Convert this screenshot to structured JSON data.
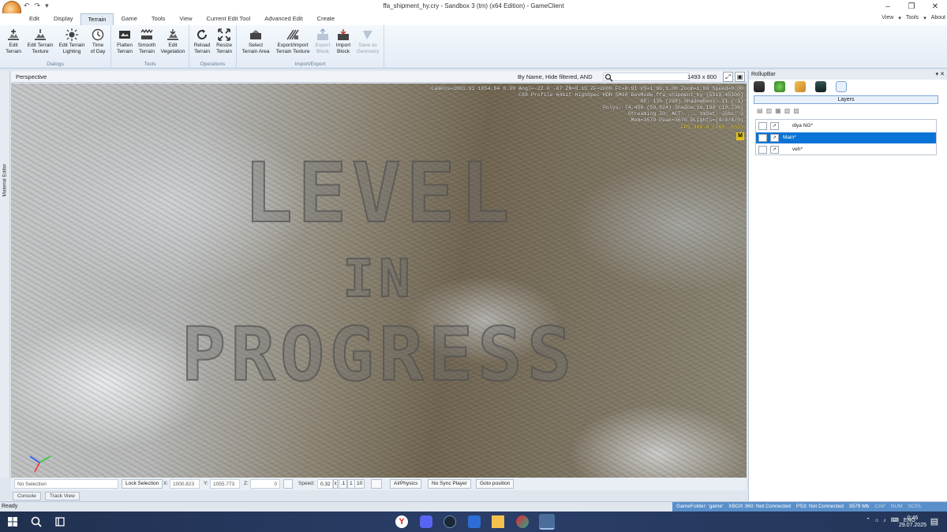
{
  "window": {
    "title": "ffa_shipment_hy.cry - Sandbox 3 (tm) (x64 Edition) - GameClient",
    "quick_access": [
      "↶",
      "↷",
      "▾"
    ],
    "controls": [
      "–",
      "❐",
      "✕"
    ]
  },
  "ribbon": {
    "tabs": [
      "Edit",
      "Display",
      "Terrain",
      "Game",
      "Tools",
      "View",
      "Current Edit Tool",
      "Advanced Edit",
      "Create"
    ],
    "active_tab": "Terrain",
    "right_menu": [
      "View",
      "Tools",
      "About"
    ],
    "groups": [
      {
        "label": "Dialogs",
        "buttons": [
          [
            "Edit",
            "Terrain"
          ],
          [
            "Edit Terrain",
            "Texture"
          ],
          [
            "Edit Terrain",
            "Lighting"
          ],
          [
            "Time",
            "of Day"
          ]
        ]
      },
      {
        "label": "Tools",
        "buttons": [
          [
            "Flatten",
            "Terrain"
          ],
          [
            "Smooth",
            "Terrain"
          ],
          [
            "Edit",
            "Vegetation"
          ]
        ]
      },
      {
        "label": "Operations",
        "buttons": [
          [
            "Reload",
            "Terrain"
          ],
          [
            "Resize",
            "Terrain"
          ]
        ]
      },
      {
        "label": "Import/Export",
        "buttons": [
          [
            "Select",
            "Terrain Area"
          ],
          [
            "Export/Import",
            "Terrain Texture"
          ],
          [
            "Export",
            "Block"
          ],
          [
            "Import",
            "Block"
          ],
          [
            "Save as",
            "Geometry"
          ]
        ]
      }
    ]
  },
  "viewport": {
    "title": "Perspective",
    "filter": "By Name, Hide filtered, AND",
    "resolution": "1493 x 800",
    "hud": [
      "CamPos=1001.91 1054.84 0.99 Angl=-22  0 -67 ZN=0.15 ZF=2000 FC=0.91 VS=1.00,1.00 Zoom=1.00 Speed=0.00",
      "CX8 Profile 64bit HighSpec HDR SM30 DevMode ffa_shipment_hy [5519.45100]",
      "DP: 135 (298) ShadowGens: 11 (-1)",
      "Polys: 74,456 (59,824) Shadow:16,199 (19,736)",
      "Streaming IO: ACT:  ...   zmSet: Jobs: 3",
      "Mem=3579 Peak=3670 DLights=(4/4/4/0)",
      "FPS 300.0 (760..833)"
    ],
    "hud_marker": "M",
    "overlay": [
      "LEVEL",
      "IN",
      "PROGRESS"
    ]
  },
  "left_panel": {
    "label": "Material Editor"
  },
  "status_toolbar": {
    "selection": "No Selection",
    "lock_selection": "Lock Selection",
    "x_label": "X:",
    "x": "1000.823",
    "y_label": "Y:",
    "y": "1055.773",
    "z_label": "Z:",
    "z": "0",
    "speed_label": "Speed:",
    "speed": "0.32",
    "speed_presets": [
      ".1",
      "1",
      "10"
    ],
    "ai_physics": "AI/Physics",
    "sync_player": "No Sync Player",
    "goto": "Goto position"
  },
  "console_tabs": [
    "Console",
    "Track View"
  ],
  "rollup": {
    "title": "RollupBar",
    "header_controls": "▾ ✕",
    "layers_button": "Layers",
    "layers": [
      {
        "name": "dlya NG*",
        "selected": false
      },
      {
        "name": "Main*",
        "selected": true
      },
      {
        "name": "veh*",
        "selected": false
      }
    ]
  },
  "statusbar": {
    "ready": "Ready",
    "items": [
      "GameFolder: 'game'",
      "XBOX 360: Not Connected",
      "PS3: Not Connected",
      "3579 Mb",
      "CAP",
      "NUM",
      "SCRL"
    ]
  },
  "taskbar": {
    "lang": "ENG",
    "time": "0:46",
    "date": "29.07.2025"
  },
  "colors": {
    "accent": "#0a73d6",
    "statusbar": "#5a8fc9",
    "taskbar": "#233659",
    "hud_fps": "#ffe14a"
  }
}
